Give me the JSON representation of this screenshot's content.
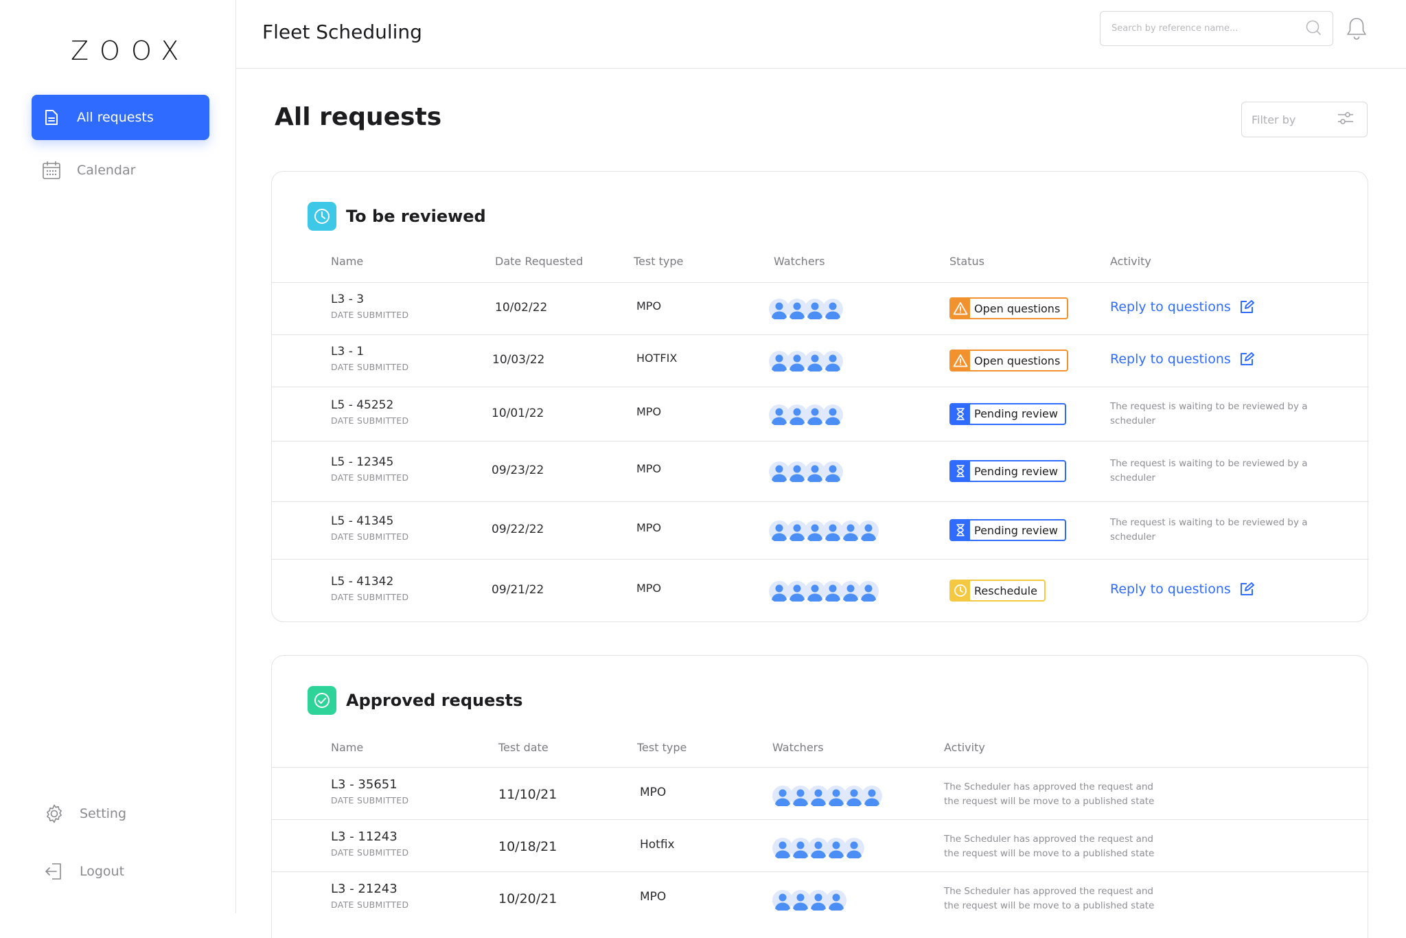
{
  "brand": {
    "logo": "ZOOX"
  },
  "sidebar": {
    "items": [
      {
        "label": "All requests",
        "icon": "document-icon"
      },
      {
        "label": "Calendar",
        "icon": "calendar-icon"
      }
    ],
    "bottom": [
      {
        "label": "Setting",
        "icon": "gear-icon"
      },
      {
        "label": "Logout",
        "icon": "logout-icon"
      }
    ]
  },
  "header": {
    "title": "Fleet Scheduling",
    "search_placeholder": "Search by reference name..."
  },
  "main": {
    "title": "All requests",
    "filter_label": "Filter by"
  },
  "colors": {
    "accent": "#2f6bff",
    "warning": "#f2922f",
    "reschedule": "#f5c842",
    "review_badge": "#3ec8e8",
    "approved_badge": "#2ed39a",
    "watcher": "#4b8ef5"
  },
  "review": {
    "title": "To be reviewed",
    "columns": [
      "Name",
      "Date Requested",
      "Test type",
      "Watchers",
      "Status",
      "Activity"
    ],
    "sub_label": "DATE SUBMITTED",
    "rows": [
      {
        "name": "L3 - 3",
        "date": "10/02/22",
        "type": "MPO",
        "watchers": 4,
        "status": "Open questions",
        "status_kind": "warn",
        "activity": "Reply to questions",
        "activity_kind": "link"
      },
      {
        "name": "L3 - 1",
        "date": "10/03/22",
        "type": "HOTFIX",
        "watchers": 4,
        "status": "Open questions",
        "status_kind": "warn",
        "activity": "Reply to questions",
        "activity_kind": "link"
      },
      {
        "name": "L5 - 45252",
        "date": "10/01/22",
        "type": "MPO",
        "watchers": 4,
        "status": "Pending review",
        "status_kind": "pend",
        "activity": "The request is  waiting to be reviewed by a scheduler",
        "activity_kind": "text"
      },
      {
        "name": "L5 - 12345",
        "date": "09/23/22",
        "type": "MPO",
        "watchers": 4,
        "status": "Pending review",
        "status_kind": "pend",
        "activity": "The request is  waiting to be reviewed by a scheduler",
        "activity_kind": "text"
      },
      {
        "name": "L5 - 41345",
        "date": "09/22/22",
        "type": "MPO",
        "watchers": 6,
        "status": "Pending review",
        "status_kind": "pend",
        "activity": "The request is  waiting to be reviewed by a scheduler",
        "activity_kind": "text"
      },
      {
        "name": "L5 - 41342",
        "date": "09/21/22",
        "type": "MPO",
        "watchers": 6,
        "status": "Reschedule",
        "status_kind": "resc",
        "activity": "Reply to questions",
        "activity_kind": "link"
      }
    ]
  },
  "approved": {
    "title": "Approved requests",
    "columns": [
      "Name",
      "Test date",
      "Test type",
      "Watchers",
      "Activity"
    ],
    "sub_label": "DATE SUBMITTED",
    "rows": [
      {
        "name": "L3 - 35651",
        "date": "11/10/21",
        "type": "MPO",
        "watchers": 6,
        "activity": "The Scheduler has approved the request and the request will be move to a published state"
      },
      {
        "name": "L3 - 11243",
        "date": "10/18/21",
        "type": "Hotfix",
        "watchers": 5,
        "activity": "The Scheduler has approved the request and the request will be move to a published state"
      },
      {
        "name": "L3 - 21243",
        "date": "10/20/21",
        "type": "MPO",
        "watchers": 4,
        "activity": "The Scheduler has approved the request and the request will be move to a published state"
      }
    ]
  }
}
